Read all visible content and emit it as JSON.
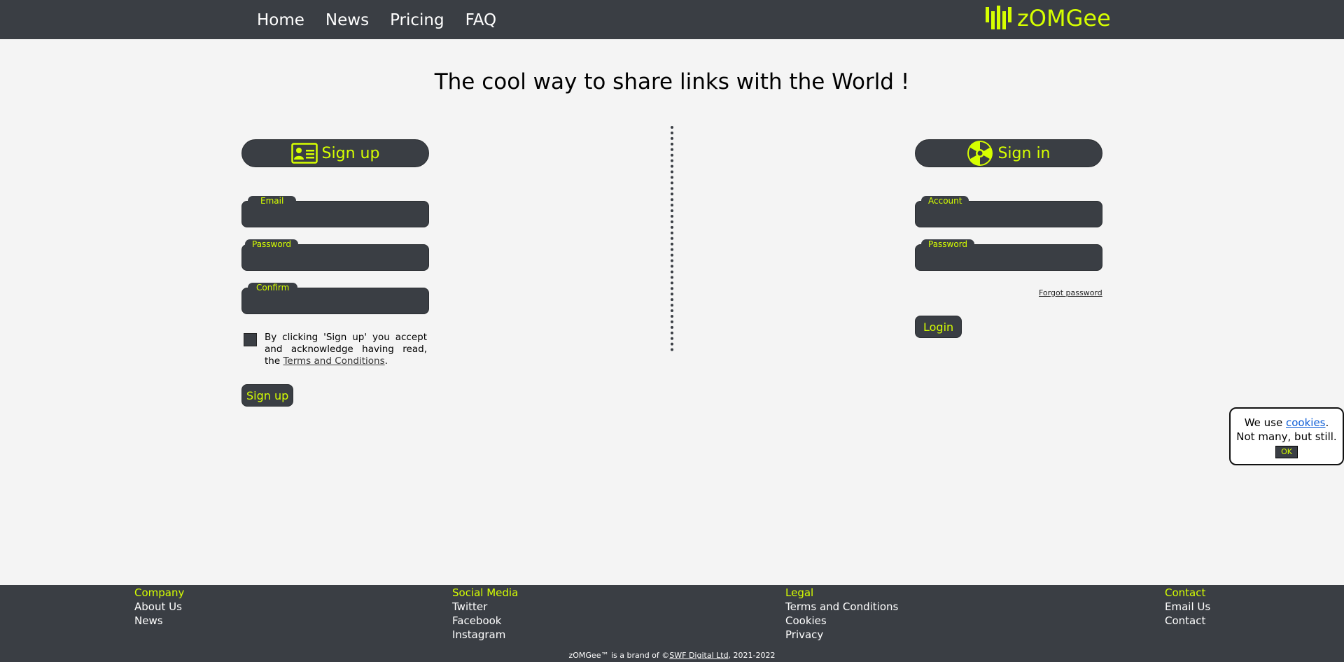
{
  "nav": {
    "items": [
      "Home",
      "News",
      "Pricing",
      "FAQ"
    ]
  },
  "brand": {
    "logo_text": "zOMGee",
    "logo_icon": "bars-logo-icon"
  },
  "headline": "The cool way to share links with the World !",
  "signup": {
    "title": "Sign up",
    "icon": "id-card-icon",
    "fields": {
      "email_label": "Email",
      "password_label": "Password",
      "confirm_label": "Confirm"
    },
    "terms_prefix": "By clicking 'Sign up' you accept and acknowledge having read, the",
    "terms_link": "Terms and Conditions",
    "terms_suffix": ".",
    "submit_label": "Sign up"
  },
  "signin": {
    "title": "Sign in",
    "icon": "radiation-icon",
    "fields": {
      "account_label": "Account",
      "password_label": "Password"
    },
    "forgot_label": "Forgot password",
    "submit_label": "Login"
  },
  "cookie": {
    "prefix": "We use",
    "link": "cookies",
    "suffix": ".",
    "line2": "Not many, but still.",
    "ok_label": "OK"
  },
  "footer": {
    "company": {
      "title": "Company",
      "links": [
        "About Us",
        "News"
      ]
    },
    "social": {
      "title": "Social Media",
      "links": [
        "Twitter",
        "Facebook",
        "Instagram"
      ]
    },
    "legal": {
      "title": "Legal",
      "links": [
        "Terms and Conditions",
        "Cookies",
        "Privacy"
      ]
    },
    "contact": {
      "title": "Contact",
      "links": [
        "Email Us",
        "Contact"
      ]
    },
    "copyright_prefix": "zOMGee™ is a brand of ©",
    "copyright_link": "SWF Digital Ltd",
    "copyright_suffix": ", 2021-2022"
  },
  "colors": {
    "dark": "#3a3e44",
    "accent": "#d6ff00",
    "background": "#f4f4f4"
  }
}
